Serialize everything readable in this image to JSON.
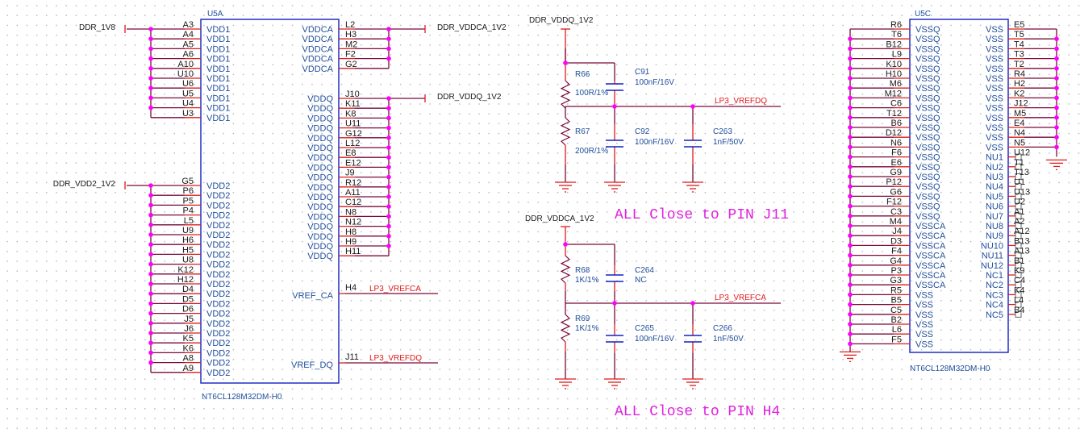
{
  "colors": {
    "wire": "#7a0a3a",
    "pin": "#e01a1a",
    "body": "#1020c0",
    "junction": "#ff00ff",
    "text_blue": "#1f4e9b",
    "net_red": "#e01a1a",
    "note": "#e020e0",
    "cap": "#1020c0"
  },
  "u5a": {
    "ref": "U5A",
    "part": "NT6CL128M32DM-H0",
    "left_groups": [
      {
        "net": "DDR_1V8",
        "pins": [
          {
            "num": "A3",
            "name": "VDD1"
          },
          {
            "num": "A4",
            "name": "VDD1"
          },
          {
            "num": "A5",
            "name": "VDD1"
          },
          {
            "num": "A6",
            "name": "VDD1"
          },
          {
            "num": "A10",
            "name": "VDD1"
          },
          {
            "num": "U10",
            "name": "VDD1"
          },
          {
            "num": "U6",
            "name": "VDD1"
          },
          {
            "num": "U5",
            "name": "VDD1"
          },
          {
            "num": "U4",
            "name": "VDD1"
          },
          {
            "num": "U3",
            "name": "VDD1"
          }
        ]
      },
      {
        "net": "DDR_VDD2_1V2",
        "pins": [
          {
            "num": "G5",
            "name": "VDD2"
          },
          {
            "num": "P6",
            "name": "VDD2"
          },
          {
            "num": "P5",
            "name": "VDD2"
          },
          {
            "num": "P4",
            "name": "VDD2"
          },
          {
            "num": "L5",
            "name": "VDD2"
          },
          {
            "num": "U9",
            "name": "VDD2"
          },
          {
            "num": "H6",
            "name": "VDD2"
          },
          {
            "num": "H5",
            "name": "VDD2"
          },
          {
            "num": "U8",
            "name": "VDD2"
          },
          {
            "num": "K12",
            "name": "VDD2"
          },
          {
            "num": "H12",
            "name": "VDD2"
          },
          {
            "num": "D4",
            "name": "VDD2"
          },
          {
            "num": "D5",
            "name": "VDD2"
          },
          {
            "num": "D6",
            "name": "VDD2"
          },
          {
            "num": "J5",
            "name": "VDD2"
          },
          {
            "num": "J6",
            "name": "VDD2"
          },
          {
            "num": "K5",
            "name": "VDD2"
          },
          {
            "num": "K6",
            "name": "VDD2"
          },
          {
            "num": "A8",
            "name": "VDD2"
          },
          {
            "num": "A9",
            "name": "VDD2"
          }
        ]
      }
    ],
    "right_groups": [
      {
        "net": "DDR_VDDCA_1V2",
        "pins": [
          {
            "num": "L2",
            "name": "VDDCA"
          },
          {
            "num": "H3",
            "name": "VDDCA"
          },
          {
            "num": "M2",
            "name": "VDDCA"
          },
          {
            "num": "F2",
            "name": "VDDCA"
          },
          {
            "num": "G2",
            "name": "VDDCA"
          }
        ]
      },
      {
        "net": "DDR_VDDQ_1V2",
        "pins": [
          {
            "num": "J10",
            "name": "VDDQ"
          },
          {
            "num": "K11",
            "name": "VDDQ"
          },
          {
            "num": "K8",
            "name": "VDDQ"
          },
          {
            "num": "U11",
            "name": "VDDQ"
          },
          {
            "num": "G12",
            "name": "VDDQ"
          },
          {
            "num": "L12",
            "name": "VDDQ"
          },
          {
            "num": "E8",
            "name": "VDDQ"
          },
          {
            "num": "E12",
            "name": "VDDQ"
          },
          {
            "num": "J9",
            "name": "VDDQ"
          },
          {
            "num": "R12",
            "name": "VDDQ"
          },
          {
            "num": "A11",
            "name": "VDDQ"
          },
          {
            "num": "C12",
            "name": "VDDQ"
          },
          {
            "num": "N8",
            "name": "VDDQ"
          },
          {
            "num": "N12",
            "name": "VDDQ"
          },
          {
            "num": "H8",
            "name": "VDDQ"
          },
          {
            "num": "H9",
            "name": "VDDQ"
          },
          {
            "num": "H11",
            "name": "VDDQ"
          }
        ]
      }
    ],
    "vref_pins": [
      {
        "num": "H4",
        "name": "VREF_CA",
        "net": "LP3_VREFCA"
      },
      {
        "num": "J11",
        "name": "VREF_DQ",
        "net": "LP3_VREFDQ"
      }
    ]
  },
  "u5c": {
    "ref": "U5C",
    "part": "NT6CL128M32DM-H0",
    "left_pins": [
      {
        "num": "R6",
        "name": "VSSQ"
      },
      {
        "num": "T6",
        "name": "VSSQ"
      },
      {
        "num": "B12",
        "name": "VSSQ"
      },
      {
        "num": "L9",
        "name": "VSSQ"
      },
      {
        "num": "K10",
        "name": "VSSQ"
      },
      {
        "num": "H10",
        "name": "VSSQ"
      },
      {
        "num": "M6",
        "name": "VSSQ"
      },
      {
        "num": "M12",
        "name": "VSSQ"
      },
      {
        "num": "C6",
        "name": "VSSQ"
      },
      {
        "num": "T12",
        "name": "VSSQ"
      },
      {
        "num": "B6",
        "name": "VSSQ"
      },
      {
        "num": "D12",
        "name": "VSSQ"
      },
      {
        "num": "N6",
        "name": "VSSQ"
      },
      {
        "num": "F6",
        "name": "VSSQ"
      },
      {
        "num": "E6",
        "name": "VSSQ"
      },
      {
        "num": "G9",
        "name": "VSSQ"
      },
      {
        "num": "P12",
        "name": "VSSQ"
      },
      {
        "num": "G6",
        "name": "VSSQ"
      },
      {
        "num": "F12",
        "name": "VSSQ"
      },
      {
        "num": "C3",
        "name": "VSSQ"
      },
      {
        "num": "M4",
        "name": "VSSCA"
      },
      {
        "num": "J4",
        "name": "VSSCA"
      },
      {
        "num": "D3",
        "name": "VSSCA"
      },
      {
        "num": "F4",
        "name": "VSSCA"
      },
      {
        "num": "G4",
        "name": "VSSCA"
      },
      {
        "num": "P3",
        "name": "VSSCA"
      },
      {
        "num": "G3",
        "name": "VSSCA"
      },
      {
        "num": "R5",
        "name": "VSS"
      },
      {
        "num": "B5",
        "name": "VSS"
      },
      {
        "num": "C5",
        "name": "VSS"
      },
      {
        "num": "B2",
        "name": "VSS"
      },
      {
        "num": "L6",
        "name": "VSS"
      },
      {
        "num": "F5",
        "name": "VSS"
      }
    ],
    "right_vss_pins": [
      {
        "num": "E5",
        "name": "VSS"
      },
      {
        "num": "T5",
        "name": "VSS"
      },
      {
        "num": "T4",
        "name": "VSS"
      },
      {
        "num": "T3",
        "name": "VSS"
      },
      {
        "num": "T2",
        "name": "VSS"
      },
      {
        "num": "R4",
        "name": "VSS"
      },
      {
        "num": "H2",
        "name": "VSS"
      },
      {
        "num": "K2",
        "name": "VSS"
      },
      {
        "num": "J12",
        "name": "VSS"
      },
      {
        "num": "M5",
        "name": "VSS"
      },
      {
        "num": "E4",
        "name": "VSS"
      },
      {
        "num": "N4",
        "name": "VSS"
      },
      {
        "num": "N5",
        "name": "VSS"
      }
    ],
    "right_nc_pins": [
      {
        "num": "U12",
        "name": "NU1"
      },
      {
        "num": "T1",
        "name": "NU2"
      },
      {
        "num": "T13",
        "name": "NU3"
      },
      {
        "num": "U1",
        "name": "NU4"
      },
      {
        "num": "U13",
        "name": "NU5"
      },
      {
        "num": "U2",
        "name": "NU6"
      },
      {
        "num": "A1",
        "name": "NU7"
      },
      {
        "num": "A2",
        "name": "NU8"
      },
      {
        "num": "A12",
        "name": "NU9"
      },
      {
        "num": "B13",
        "name": "NU10"
      },
      {
        "num": "A13",
        "name": "NU11"
      },
      {
        "num": "B1",
        "name": "NU12"
      },
      {
        "num": "K9",
        "name": "NC1"
      },
      {
        "num": "C4",
        "name": "NC2"
      },
      {
        "num": "K4",
        "name": "NC3"
      },
      {
        "num": "L4",
        "name": "NC4"
      },
      {
        "num": "B4",
        "name": "NC5"
      }
    ]
  },
  "vrefdq_circuit": {
    "supply": "DDR_VDDQ_1V2",
    "output_net": "LP3_VREFDQ",
    "r_top": {
      "ref": "R66",
      "value": "100R/1%"
    },
    "r_bottom": {
      "ref": "R67",
      "value": "200R/1%"
    },
    "c_top": {
      "ref": "C91",
      "value": "100nF/16V"
    },
    "c_bottom": {
      "ref": "C92",
      "value": "100nF/16V"
    },
    "c_out": {
      "ref": "C263",
      "value": "1nF/50V"
    },
    "note": "ALL Close to PIN J11"
  },
  "vrefca_circuit": {
    "supply": "DDR_VDDCA_1V2",
    "output_net": "LP3_VREFCA",
    "r_top": {
      "ref": "R68",
      "value": "1K/1%"
    },
    "r_bottom": {
      "ref": "R69",
      "value": "1K/1%"
    },
    "c_top": {
      "ref": "C264",
      "value": "NC"
    },
    "c_bottom": {
      "ref": "C265",
      "value": "100nF/16V"
    },
    "c_out": {
      "ref": "C266",
      "value": "1nF/50V"
    },
    "note": "ALL Close to PIN H4"
  }
}
